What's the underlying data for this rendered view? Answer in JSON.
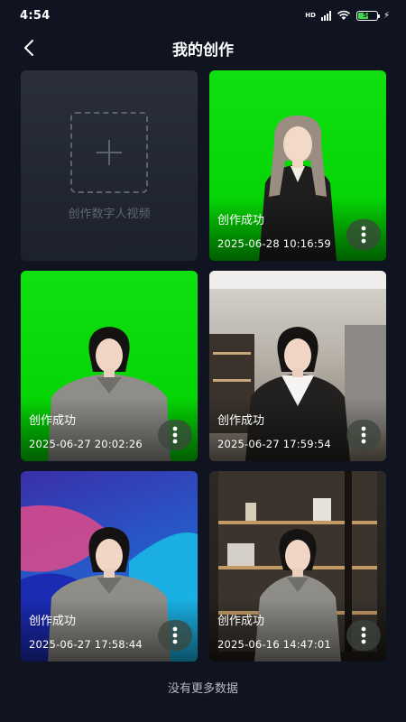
{
  "status_bar": {
    "time": "4:54",
    "network_label": "HD",
    "battery_level": "56",
    "battery_color": "#3ddc4a"
  },
  "header": {
    "title": "我的创作",
    "back_icon": "chevron-left-icon"
  },
  "create_card": {
    "label": "创作数字人视频",
    "icon": "plus-icon"
  },
  "videos": [
    {
      "status": "创作成功",
      "date": "2025-06-28 10:16:59",
      "background": "green-screen"
    },
    {
      "status": "创作成功",
      "date": "2025-06-27 20:02:26",
      "background": "green-screen"
    },
    {
      "status": "创作成功",
      "date": "2025-06-27 17:59:54",
      "background": "office"
    },
    {
      "status": "创作成功",
      "date": "2025-06-27 17:58:44",
      "background": "blue-abstract"
    },
    {
      "status": "创作成功",
      "date": "2025-06-16 14:47:01",
      "background": "bookshelf"
    }
  ],
  "more_icon": "more-vertical-icon",
  "footer": {
    "text": "没有更多数据"
  }
}
